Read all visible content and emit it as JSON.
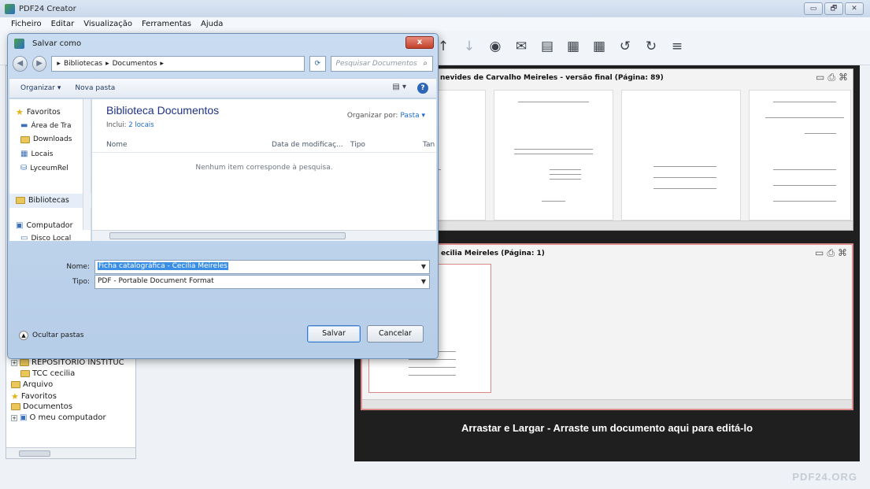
{
  "app": {
    "title": "PDF24 Creator",
    "window_controls": [
      "▭",
      "🗗",
      "✕"
    ],
    "menu": [
      "Ficheiro",
      "Editar",
      "Visualização",
      "Ferramentas",
      "Ajuda"
    ],
    "brand": "PDF24.ORG"
  },
  "tree": {
    "items": [
      {
        "label": "REPOSITÓRIO INSTITUC",
        "icon": "folder-icon"
      },
      {
        "label": "TCC cecilia",
        "icon": "folder-icon"
      },
      {
        "label": "Arquivo",
        "icon": "folder-icon"
      },
      {
        "label": "Favoritos",
        "icon": "star-icon"
      },
      {
        "label": "Documentos",
        "icon": "folder-icon"
      },
      {
        "label": "O meu computador",
        "icon": "computer-icon"
      }
    ]
  },
  "panels": {
    "top_title": "nevides de Carvalho Meireles - versão final (Página: 89)",
    "bottom_title": "ecilia Meireles (Página: 1)",
    "drop_text": "Arrastar e Largar - Arraste um documento aqui para editá-lo"
  },
  "dialog": {
    "title": "Salvar como",
    "close": "x",
    "breadcrumb": [
      "Bibliotecas",
      "Documentos"
    ],
    "search_placeholder": "Pesquisar Documentos",
    "organize": "Organizar ▾",
    "new_folder": "Nova pasta",
    "nav": {
      "favorites": "Favoritos",
      "fav_items": [
        "Área de Tra",
        "Downloads",
        "Locais",
        "LyceumRel"
      ],
      "libraries": "Bibliotecas",
      "computer": "Computador",
      "disk": "Disco Local"
    },
    "library_title": "Biblioteca Documentos",
    "includes_prefix": "Inclui:",
    "includes_link": "2 locais",
    "arrange_by": "Organizar por:",
    "arrange_value": "Pasta ▾",
    "columns": [
      "Nome",
      "Data de modificaç...",
      "Tipo",
      "Tan"
    ],
    "empty_message": "Nenhum item corresponde à pesquisa.",
    "filename_label": "Nome:",
    "filename_value": "Ficha catalográfica - Cecilia Meireles",
    "type_label": "Tipo:",
    "type_value": "PDF - Portable Document Format",
    "hide_folders": "Ocultar pastas",
    "save": "Salvar",
    "cancel": "Cancelar"
  }
}
